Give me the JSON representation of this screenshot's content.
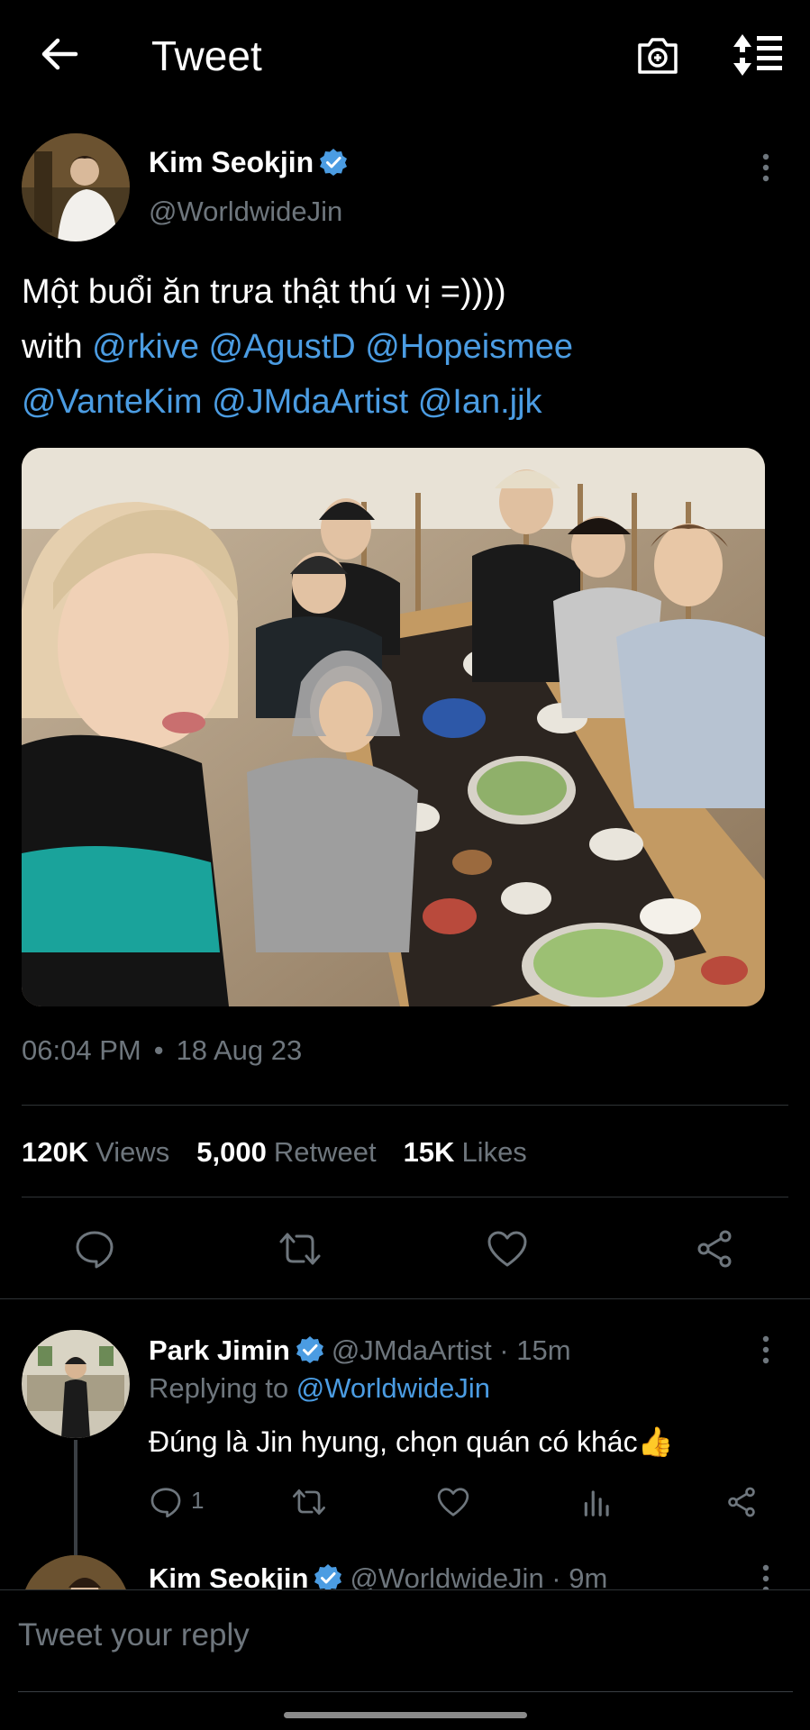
{
  "header": {
    "title": "Tweet"
  },
  "tweet": {
    "author_name": "Kim Seokjin",
    "author_handle": "@WorldwideJin",
    "text_line1": "Một buổi ăn trưa thật thú vị =))))",
    "with_word": "with",
    "mentions": [
      "@rkive",
      "@AgustD",
      "@Hopeismee",
      "@VanteKim",
      "@JMdaArtist",
      "@Ian.jjk"
    ],
    "time": "06:04 PM",
    "separator": "•",
    "date": "18 Aug 23",
    "stats": {
      "views_count": "120K",
      "views_label": "Views",
      "retweets_count": "5,000",
      "retweets_label": "Retweet",
      "likes_count": "15K",
      "likes_label": "Likes"
    }
  },
  "reply": {
    "author_name": "Park Jimin",
    "author_handle": "@JMdaArtist · 15m",
    "replying_prefix": "Replying to",
    "replying_handle": "@WorldwideJin",
    "text": "Đúng là Jin hyung, chọn quán có khác👍",
    "reply_count": "1"
  },
  "next_reply": {
    "author_name": "Kim Seokjin",
    "author_handle": "@WorldwideJin · 9m"
  },
  "compose": {
    "placeholder": "Tweet your reply"
  },
  "colors": {
    "accent": "#4b9ce2",
    "muted": "#6e767d",
    "background": "#000000"
  },
  "icons": [
    "back-arrow-icon",
    "camera-icon",
    "sort-icon",
    "verified-icon",
    "more-icon",
    "reply-icon",
    "retweet-icon",
    "like-icon",
    "share-icon",
    "analytics-icon"
  ]
}
